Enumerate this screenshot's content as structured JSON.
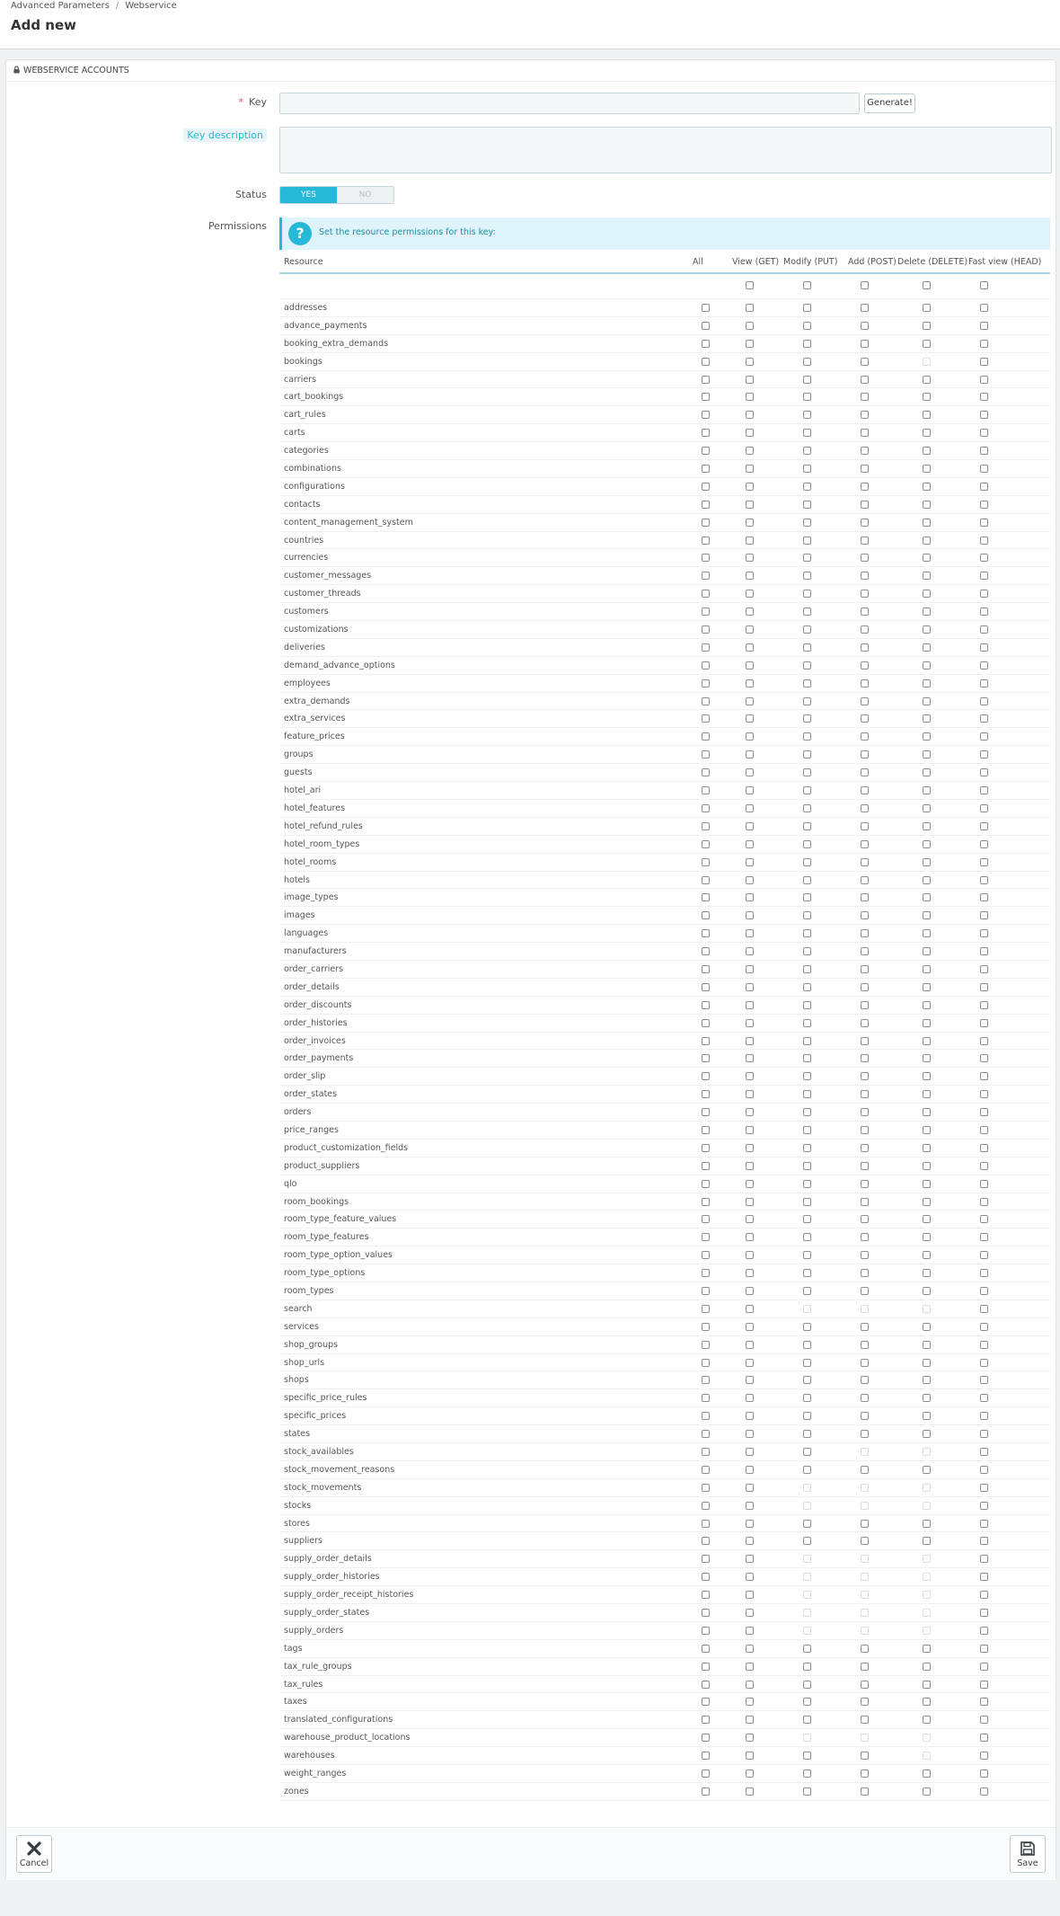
{
  "breadcrumb": {
    "parent": "Advanced Parameters",
    "sep": "/",
    "current": "Webservice"
  },
  "page_title": "Add new",
  "panel": {
    "heading": "WEBSERVICE ACCOUNTS",
    "icon": "lock-icon"
  },
  "form": {
    "key_required_mark": "*",
    "key_label": "Key",
    "key_value": "",
    "generate_label": "Generate!",
    "description_label": "Key description",
    "description_value": "",
    "status_label": "Status",
    "status_yes": "YES",
    "status_no": "NO",
    "status_value": "YES",
    "permissions_label": "Permissions"
  },
  "alert": {
    "icon": "question-icon",
    "text": "Set the resource permissions for this key:"
  },
  "table": {
    "columns": [
      "Resource",
      "All",
      "View (GET)",
      "Modify (PUT)",
      "Add (POST)",
      "Delete (DELETE)",
      "Fast view (HEAD)"
    ],
    "rows": [
      {
        "name": "addresses",
        "disabled": []
      },
      {
        "name": "advance_payments",
        "disabled": []
      },
      {
        "name": "booking_extra_demands",
        "disabled": []
      },
      {
        "name": "bookings",
        "disabled": [
          "delete"
        ]
      },
      {
        "name": "carriers",
        "disabled": []
      },
      {
        "name": "cart_bookings",
        "disabled": []
      },
      {
        "name": "cart_rules",
        "disabled": []
      },
      {
        "name": "carts",
        "disabled": []
      },
      {
        "name": "categories",
        "disabled": []
      },
      {
        "name": "combinations",
        "disabled": []
      },
      {
        "name": "configurations",
        "disabled": []
      },
      {
        "name": "contacts",
        "disabled": []
      },
      {
        "name": "content_management_system",
        "disabled": []
      },
      {
        "name": "countries",
        "disabled": []
      },
      {
        "name": "currencies",
        "disabled": []
      },
      {
        "name": "customer_messages",
        "disabled": []
      },
      {
        "name": "customer_threads",
        "disabled": []
      },
      {
        "name": "customers",
        "disabled": []
      },
      {
        "name": "customizations",
        "disabled": []
      },
      {
        "name": "deliveries",
        "disabled": []
      },
      {
        "name": "demand_advance_options",
        "disabled": []
      },
      {
        "name": "employees",
        "disabled": []
      },
      {
        "name": "extra_demands",
        "disabled": []
      },
      {
        "name": "extra_services",
        "disabled": []
      },
      {
        "name": "feature_prices",
        "disabled": []
      },
      {
        "name": "groups",
        "disabled": []
      },
      {
        "name": "guests",
        "disabled": []
      },
      {
        "name": "hotel_ari",
        "disabled": []
      },
      {
        "name": "hotel_features",
        "disabled": []
      },
      {
        "name": "hotel_refund_rules",
        "disabled": []
      },
      {
        "name": "hotel_room_types",
        "disabled": []
      },
      {
        "name": "hotel_rooms",
        "disabled": []
      },
      {
        "name": "hotels",
        "disabled": []
      },
      {
        "name": "image_types",
        "disabled": []
      },
      {
        "name": "images",
        "disabled": []
      },
      {
        "name": "languages",
        "disabled": []
      },
      {
        "name": "manufacturers",
        "disabled": []
      },
      {
        "name": "order_carriers",
        "disabled": []
      },
      {
        "name": "order_details",
        "disabled": []
      },
      {
        "name": "order_discounts",
        "disabled": []
      },
      {
        "name": "order_histories",
        "disabled": []
      },
      {
        "name": "order_invoices",
        "disabled": []
      },
      {
        "name": "order_payments",
        "disabled": []
      },
      {
        "name": "order_slip",
        "disabled": []
      },
      {
        "name": "order_states",
        "disabled": []
      },
      {
        "name": "orders",
        "disabled": []
      },
      {
        "name": "price_ranges",
        "disabled": []
      },
      {
        "name": "product_customization_fields",
        "disabled": []
      },
      {
        "name": "product_suppliers",
        "disabled": []
      },
      {
        "name": "qlo",
        "disabled": []
      },
      {
        "name": "room_bookings",
        "disabled": []
      },
      {
        "name": "room_type_feature_values",
        "disabled": []
      },
      {
        "name": "room_type_features",
        "disabled": []
      },
      {
        "name": "room_type_option_values",
        "disabled": []
      },
      {
        "name": "room_type_options",
        "disabled": []
      },
      {
        "name": "room_types",
        "disabled": []
      },
      {
        "name": "search",
        "disabled": [
          "put",
          "post",
          "delete"
        ]
      },
      {
        "name": "services",
        "disabled": []
      },
      {
        "name": "shop_groups",
        "disabled": []
      },
      {
        "name": "shop_urls",
        "disabled": []
      },
      {
        "name": "shops",
        "disabled": []
      },
      {
        "name": "specific_price_rules",
        "disabled": []
      },
      {
        "name": "specific_prices",
        "disabled": []
      },
      {
        "name": "states",
        "disabled": []
      },
      {
        "name": "stock_availables",
        "disabled": [
          "post",
          "delete"
        ]
      },
      {
        "name": "stock_movement_reasons",
        "disabled": []
      },
      {
        "name": "stock_movements",
        "disabled": [
          "put",
          "post",
          "delete"
        ]
      },
      {
        "name": "stocks",
        "disabled": [
          "put",
          "post",
          "delete"
        ]
      },
      {
        "name": "stores",
        "disabled": []
      },
      {
        "name": "suppliers",
        "disabled": []
      },
      {
        "name": "supply_order_details",
        "disabled": [
          "put",
          "post",
          "delete"
        ]
      },
      {
        "name": "supply_order_histories",
        "disabled": [
          "put",
          "post",
          "delete"
        ]
      },
      {
        "name": "supply_order_receipt_histories",
        "disabled": [
          "put",
          "post",
          "delete"
        ]
      },
      {
        "name": "supply_order_states",
        "disabled": [
          "put",
          "post",
          "delete"
        ]
      },
      {
        "name": "supply_orders",
        "disabled": [
          "put",
          "post",
          "delete"
        ]
      },
      {
        "name": "tags",
        "disabled": []
      },
      {
        "name": "tax_rule_groups",
        "disabled": []
      },
      {
        "name": "tax_rules",
        "disabled": []
      },
      {
        "name": "taxes",
        "disabled": []
      },
      {
        "name": "translated_configurations",
        "disabled": []
      },
      {
        "name": "warehouse_product_locations",
        "disabled": [
          "put",
          "post",
          "delete"
        ]
      },
      {
        "name": "warehouses",
        "disabled": [
          "delete"
        ]
      },
      {
        "name": "weight_ranges",
        "disabled": []
      },
      {
        "name": "zones",
        "disabled": []
      }
    ]
  },
  "footer": {
    "cancel_label": "Cancel",
    "cancel_icon": "close-icon",
    "save_label": "Save",
    "save_icon": "floppy-disk-icon"
  },
  "colors": {
    "accent": "#25b9d7",
    "required": "#e84e6a",
    "background": "#eff1f2"
  }
}
